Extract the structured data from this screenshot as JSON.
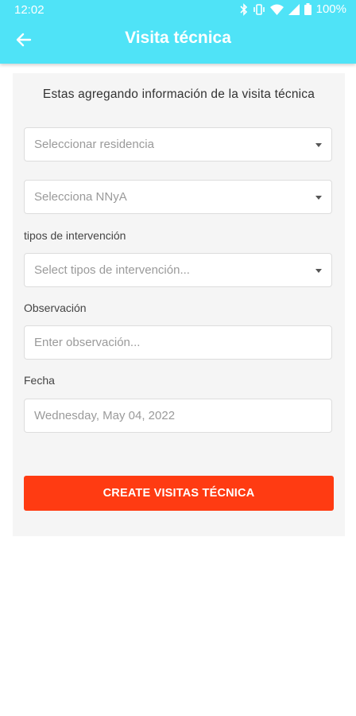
{
  "status_bar": {
    "time": "12:02",
    "battery": "100%"
  },
  "app_bar": {
    "title": "Visita técnica"
  },
  "form": {
    "heading": "Estas agregando información de la visita técnica",
    "residencia_placeholder": "Seleccionar residencia",
    "nnya_placeholder": "Selecciona NNyA",
    "tipos_label": "tipos de intervención",
    "tipos_placeholder": "Select tipos de intervención...",
    "observacion_label": "Observación",
    "observacion_placeholder": "Enter observación...",
    "fecha_label": "Fecha",
    "fecha_value": "Wednesday, May 04, 2022",
    "submit_label": "CREATE VISITAS TÉCNICA"
  },
  "colors": {
    "app_bar": "#4fe3f7",
    "button": "#ff3b12",
    "card": "#f5f5f5"
  },
  "icons": [
    "back-arrow-icon",
    "bluetooth-icon",
    "vibrate-icon",
    "wifi-icon",
    "signal-icon",
    "battery-icon",
    "dropdown-caret-icon"
  ]
}
